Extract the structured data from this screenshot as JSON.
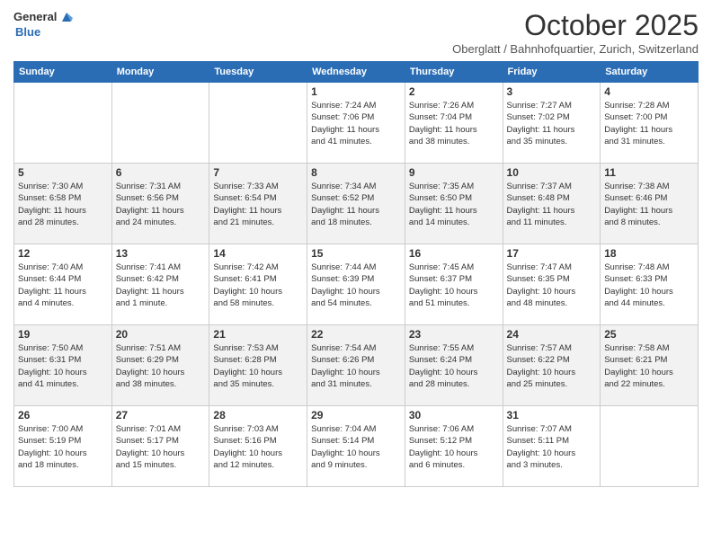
{
  "header": {
    "logo_general": "General",
    "logo_blue": "Blue",
    "month_title": "October 2025",
    "location": "Oberglatt / Bahnhofquartier, Zurich, Switzerland"
  },
  "weekdays": [
    "Sunday",
    "Monday",
    "Tuesday",
    "Wednesday",
    "Thursday",
    "Friday",
    "Saturday"
  ],
  "weeks": [
    [
      {
        "day": "",
        "info": ""
      },
      {
        "day": "",
        "info": ""
      },
      {
        "day": "",
        "info": ""
      },
      {
        "day": "1",
        "info": "Sunrise: 7:24 AM\nSunset: 7:06 PM\nDaylight: 11 hours\nand 41 minutes."
      },
      {
        "day": "2",
        "info": "Sunrise: 7:26 AM\nSunset: 7:04 PM\nDaylight: 11 hours\nand 38 minutes."
      },
      {
        "day": "3",
        "info": "Sunrise: 7:27 AM\nSunset: 7:02 PM\nDaylight: 11 hours\nand 35 minutes."
      },
      {
        "day": "4",
        "info": "Sunrise: 7:28 AM\nSunset: 7:00 PM\nDaylight: 11 hours\nand 31 minutes."
      }
    ],
    [
      {
        "day": "5",
        "info": "Sunrise: 7:30 AM\nSunset: 6:58 PM\nDaylight: 11 hours\nand 28 minutes."
      },
      {
        "day": "6",
        "info": "Sunrise: 7:31 AM\nSunset: 6:56 PM\nDaylight: 11 hours\nand 24 minutes."
      },
      {
        "day": "7",
        "info": "Sunrise: 7:33 AM\nSunset: 6:54 PM\nDaylight: 11 hours\nand 21 minutes."
      },
      {
        "day": "8",
        "info": "Sunrise: 7:34 AM\nSunset: 6:52 PM\nDaylight: 11 hours\nand 18 minutes."
      },
      {
        "day": "9",
        "info": "Sunrise: 7:35 AM\nSunset: 6:50 PM\nDaylight: 11 hours\nand 14 minutes."
      },
      {
        "day": "10",
        "info": "Sunrise: 7:37 AM\nSunset: 6:48 PM\nDaylight: 11 hours\nand 11 minutes."
      },
      {
        "day": "11",
        "info": "Sunrise: 7:38 AM\nSunset: 6:46 PM\nDaylight: 11 hours\nand 8 minutes."
      }
    ],
    [
      {
        "day": "12",
        "info": "Sunrise: 7:40 AM\nSunset: 6:44 PM\nDaylight: 11 hours\nand 4 minutes."
      },
      {
        "day": "13",
        "info": "Sunrise: 7:41 AM\nSunset: 6:42 PM\nDaylight: 11 hours\nand 1 minute."
      },
      {
        "day": "14",
        "info": "Sunrise: 7:42 AM\nSunset: 6:41 PM\nDaylight: 10 hours\nand 58 minutes."
      },
      {
        "day": "15",
        "info": "Sunrise: 7:44 AM\nSunset: 6:39 PM\nDaylight: 10 hours\nand 54 minutes."
      },
      {
        "day": "16",
        "info": "Sunrise: 7:45 AM\nSunset: 6:37 PM\nDaylight: 10 hours\nand 51 minutes."
      },
      {
        "day": "17",
        "info": "Sunrise: 7:47 AM\nSunset: 6:35 PM\nDaylight: 10 hours\nand 48 minutes."
      },
      {
        "day": "18",
        "info": "Sunrise: 7:48 AM\nSunset: 6:33 PM\nDaylight: 10 hours\nand 44 minutes."
      }
    ],
    [
      {
        "day": "19",
        "info": "Sunrise: 7:50 AM\nSunset: 6:31 PM\nDaylight: 10 hours\nand 41 minutes."
      },
      {
        "day": "20",
        "info": "Sunrise: 7:51 AM\nSunset: 6:29 PM\nDaylight: 10 hours\nand 38 minutes."
      },
      {
        "day": "21",
        "info": "Sunrise: 7:53 AM\nSunset: 6:28 PM\nDaylight: 10 hours\nand 35 minutes."
      },
      {
        "day": "22",
        "info": "Sunrise: 7:54 AM\nSunset: 6:26 PM\nDaylight: 10 hours\nand 31 minutes."
      },
      {
        "day": "23",
        "info": "Sunrise: 7:55 AM\nSunset: 6:24 PM\nDaylight: 10 hours\nand 28 minutes."
      },
      {
        "day": "24",
        "info": "Sunrise: 7:57 AM\nSunset: 6:22 PM\nDaylight: 10 hours\nand 25 minutes."
      },
      {
        "day": "25",
        "info": "Sunrise: 7:58 AM\nSunset: 6:21 PM\nDaylight: 10 hours\nand 22 minutes."
      }
    ],
    [
      {
        "day": "26",
        "info": "Sunrise: 7:00 AM\nSunset: 5:19 PM\nDaylight: 10 hours\nand 18 minutes."
      },
      {
        "day": "27",
        "info": "Sunrise: 7:01 AM\nSunset: 5:17 PM\nDaylight: 10 hours\nand 15 minutes."
      },
      {
        "day": "28",
        "info": "Sunrise: 7:03 AM\nSunset: 5:16 PM\nDaylight: 10 hours\nand 12 minutes."
      },
      {
        "day": "29",
        "info": "Sunrise: 7:04 AM\nSunset: 5:14 PM\nDaylight: 10 hours\nand 9 minutes."
      },
      {
        "day": "30",
        "info": "Sunrise: 7:06 AM\nSunset: 5:12 PM\nDaylight: 10 hours\nand 6 minutes."
      },
      {
        "day": "31",
        "info": "Sunrise: 7:07 AM\nSunset: 5:11 PM\nDaylight: 10 hours\nand 3 minutes."
      },
      {
        "day": "",
        "info": ""
      }
    ]
  ]
}
